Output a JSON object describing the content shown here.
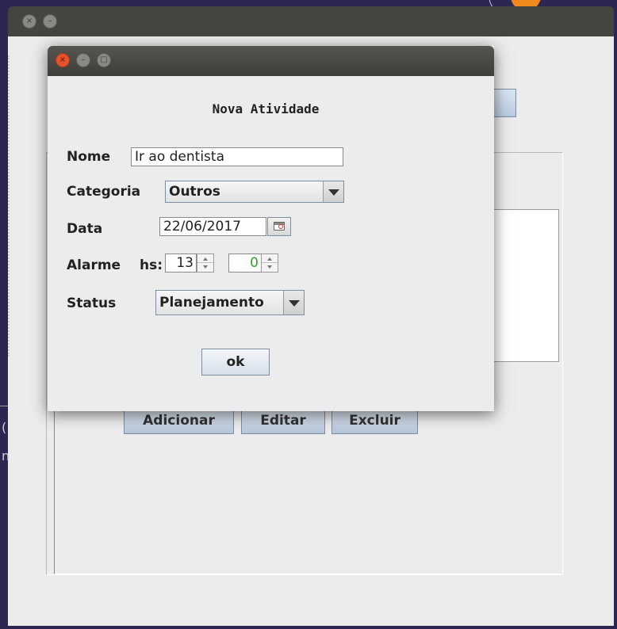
{
  "dialog": {
    "heading": "Nova Atividade",
    "nome_label": "Nome",
    "nome_value": "Ir ao dentista",
    "categoria_label": "Categoria",
    "categoria_value": "Outros",
    "data_label": "Data",
    "data_value": "22/06/2017",
    "alarme_label": "Alarme",
    "hs_label": "hs:",
    "hour_value": "13",
    "minute_value": "0",
    "status_label": "Status",
    "status_value": "Planejamento",
    "ok_label": "ok",
    "close_glyph": "×",
    "minimize_glyph": "–",
    "maximize_glyph": "□"
  },
  "back_window": {
    "close_glyph": "×",
    "minimize_glyph": "–",
    "buttons": {
      "adicionar": "Adicionar",
      "editar": "Editar",
      "excluir": "Excluir"
    }
  },
  "colors": {
    "desktop": "#2c2653",
    "titlebar": "#46443f",
    "dialog_bg": "#ececec",
    "close_button": "#e5522d",
    "minute_text": "#2fa32f"
  }
}
